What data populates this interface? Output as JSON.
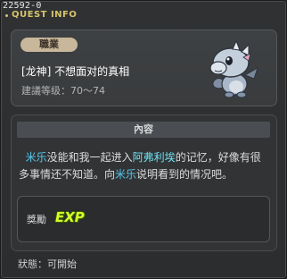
{
  "window": {
    "quest_id": "22592-0",
    "title": "QUEST INFO"
  },
  "header": {
    "job_badge": "職業",
    "quest_name": "[龙神]  不想面对的真相",
    "level_range": "建議等级：70～74",
    "npc_icon": "baby-dragon-npc-icon"
  },
  "content": {
    "section_title": "內容",
    "description": {
      "part1_name": "米乐",
      "part1_text": "没能和我一起进入",
      "part2_name": "阿弗利埃",
      "part2_text": "的记忆，好像有很多事情还不知道。向",
      "part3_name": "米乐",
      "part3_text": "说明看到的情况吧。"
    },
    "reward": {
      "label": "獎勵",
      "exp_text": "EXP"
    }
  },
  "footer": {
    "status": "狀態：可開始"
  },
  "colors": {
    "title": "#d7c46a",
    "highlight_name": "#55c8ee",
    "highlight_place": "#6fe3f0",
    "exp": "#d6ff2a",
    "badge": "#c8b79a"
  }
}
